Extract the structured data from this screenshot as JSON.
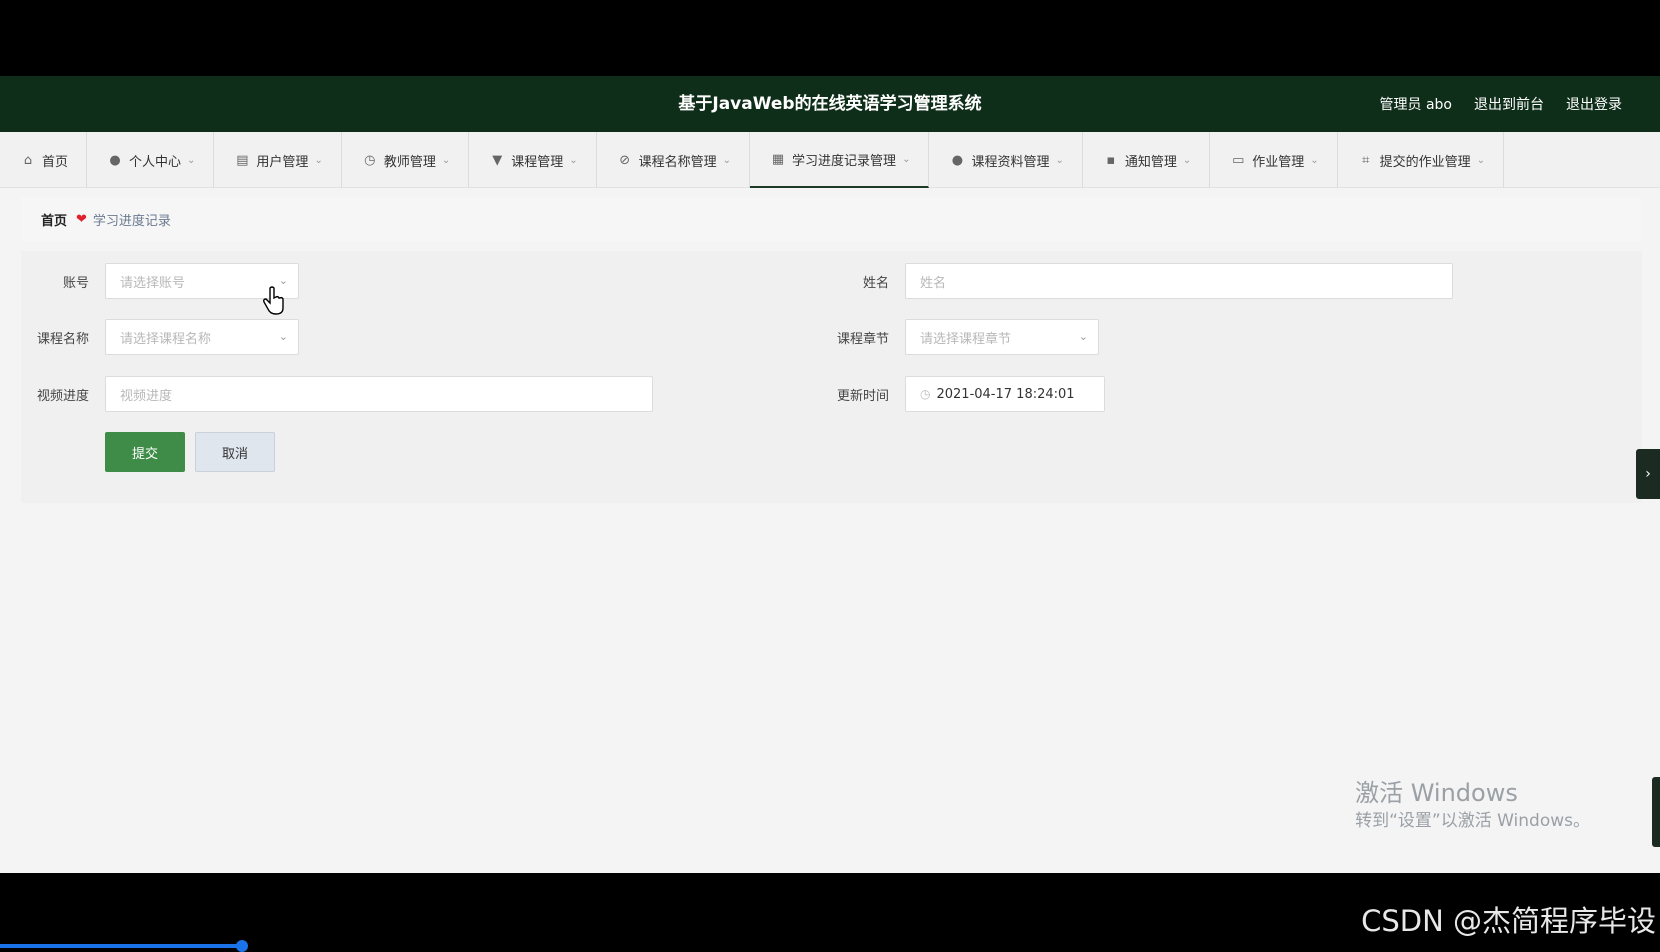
{
  "header": {
    "title": "基于JavaWeb的在线英语学习管理系统",
    "user_label": "管理员 abo",
    "to_front": "退出到前台",
    "logout": "退出登录"
  },
  "nav": [
    {
      "label": "首页",
      "icon": "home-icon",
      "chevron": false
    },
    {
      "label": "个人中心",
      "icon": "user-icon",
      "chevron": true
    },
    {
      "label": "用户管理",
      "icon": "clipboard-icon",
      "chevron": true
    },
    {
      "label": "教师管理",
      "icon": "clock-icon",
      "chevron": true
    },
    {
      "label": "课程管理",
      "icon": "pin-icon",
      "chevron": true
    },
    {
      "label": "课程名称管理",
      "icon": "bell-off-icon",
      "chevron": true
    },
    {
      "label": "学习进度记录管理",
      "icon": "grid-icon",
      "chevron": true,
      "active": true
    },
    {
      "label": "课程资料管理",
      "icon": "user-icon",
      "chevron": true
    },
    {
      "label": "通知管理",
      "icon": "apps-icon",
      "chevron": true
    },
    {
      "label": "作业管理",
      "icon": "window-icon",
      "chevron": true
    },
    {
      "label": "提交的作业管理",
      "icon": "crop-icon",
      "chevron": true
    }
  ],
  "breadcrumb": {
    "home": "首页",
    "current": "学习进度记录"
  },
  "form": {
    "account_label": "账号",
    "account_placeholder": "请选择账号",
    "name_label": "姓名",
    "name_placeholder": "姓名",
    "course_label": "课程名称",
    "course_placeholder": "请选择课程名称",
    "chapter_label": "课程章节",
    "chapter_placeholder": "请选择课程章节",
    "progress_label": "视频进度",
    "progress_placeholder": "视频进度",
    "time_label": "更新时间",
    "time_value": "2021-04-17 18:24:01",
    "submit": "提交",
    "cancel": "取消"
  },
  "watermark": {
    "line1": "激活 Windows",
    "line2": "转到“设置”以激活 Windows。"
  },
  "csdn": "CSDN @杰简程序毕设",
  "colors": {
    "header_bg": "#0f2e1a",
    "submit_bg": "#3f8c49",
    "cancel_bg": "#dfe6ee",
    "heart": "#e0202a"
  }
}
